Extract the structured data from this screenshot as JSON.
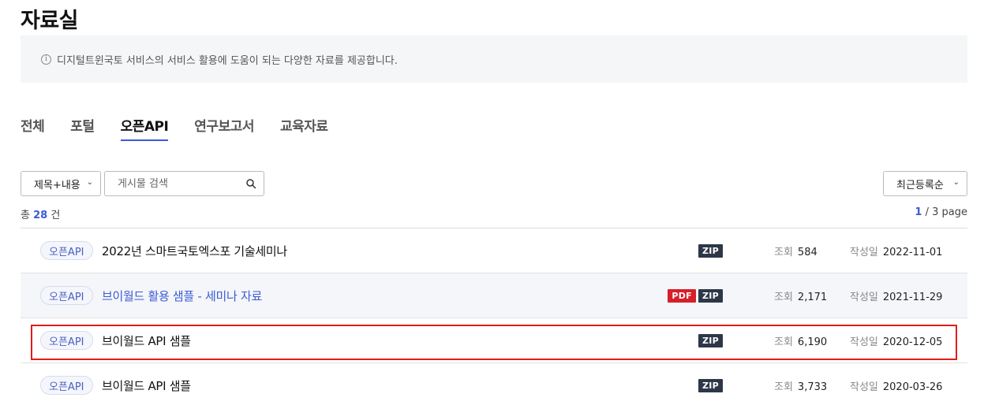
{
  "page": {
    "title": "자료실",
    "notice": "디지털트윈국토 서비스의 서비스 활용에 도움이 되는 다양한 자료를 제공합니다."
  },
  "tabs": [
    {
      "label": "전체",
      "active": false
    },
    {
      "label": "포털",
      "active": false
    },
    {
      "label": "오픈API",
      "active": true
    },
    {
      "label": "연구보고서",
      "active": false
    },
    {
      "label": "교육자료",
      "active": false
    }
  ],
  "filters": {
    "field_select": "제목+내용",
    "search_placeholder": "게시물 검색",
    "sort_select": "최근등록순"
  },
  "summary": {
    "total_prefix": "총",
    "total_count": "28",
    "total_suffix": "건",
    "current_page": "1",
    "page_total": "/ 3 page"
  },
  "labels": {
    "views": "조회",
    "date": "작성일"
  },
  "rows": [
    {
      "category": "오픈API",
      "title": "2022년 스마트국토엑스포 기술세미나",
      "files": [
        "ZIP"
      ],
      "views": "584",
      "date": "2022-11-01"
    },
    {
      "category": "오픈API",
      "title": "브이월드 활용 샘플 - 세미나 자료",
      "files": [
        "PDF",
        "ZIP"
      ],
      "views": "2,171",
      "date": "2021-11-29"
    },
    {
      "category": "오픈API",
      "title": "브이월드 API 샘플",
      "files": [
        "ZIP"
      ],
      "views": "6,190",
      "date": "2020-12-05"
    },
    {
      "category": "오픈API",
      "title": "브이월드 API 샘플",
      "files": [
        "ZIP"
      ],
      "views": "3,733",
      "date": "2020-03-26"
    }
  ],
  "colors": {
    "accent": "#3b5bd6",
    "selection_outline": "#e41b1b",
    "pdf_tag": "#d71f2a",
    "zip_tag": "#2d3748"
  }
}
